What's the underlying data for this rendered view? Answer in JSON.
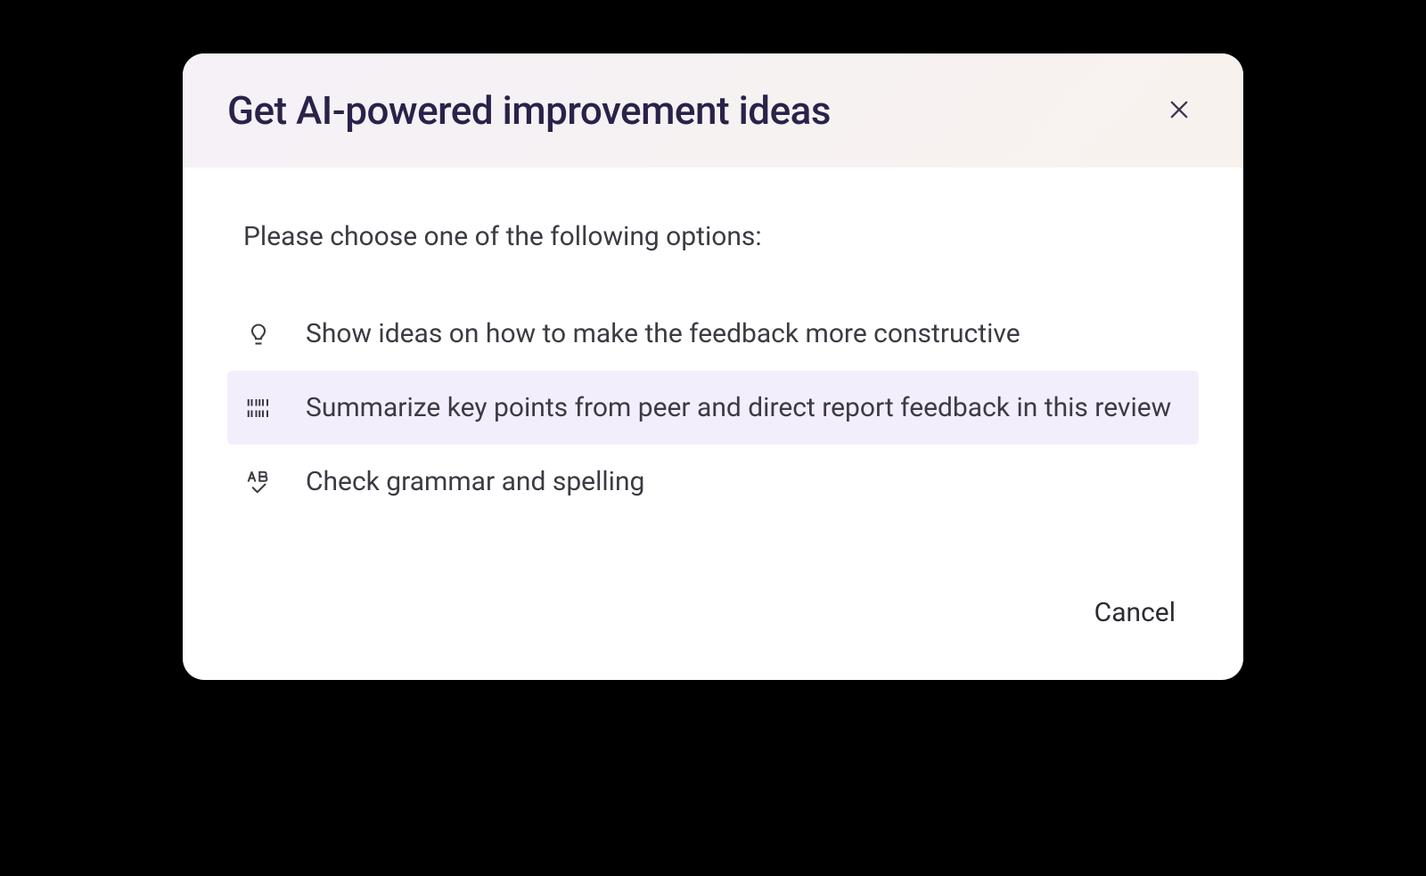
{
  "modal": {
    "title": "Get AI-powered improvement ideas",
    "prompt": "Please choose one of the following options:",
    "options": [
      {
        "icon": "lightbulb-icon",
        "label": "Show ideas on how to make the feedback more constructive",
        "selected": false
      },
      {
        "icon": "barcode-icon",
        "label": "Summarize key points from peer and direct report feedback in this review",
        "selected": true
      },
      {
        "icon": "abc-check-icon",
        "label": "Check grammar and spelling",
        "selected": false
      }
    ],
    "cancel_label": "Cancel"
  }
}
